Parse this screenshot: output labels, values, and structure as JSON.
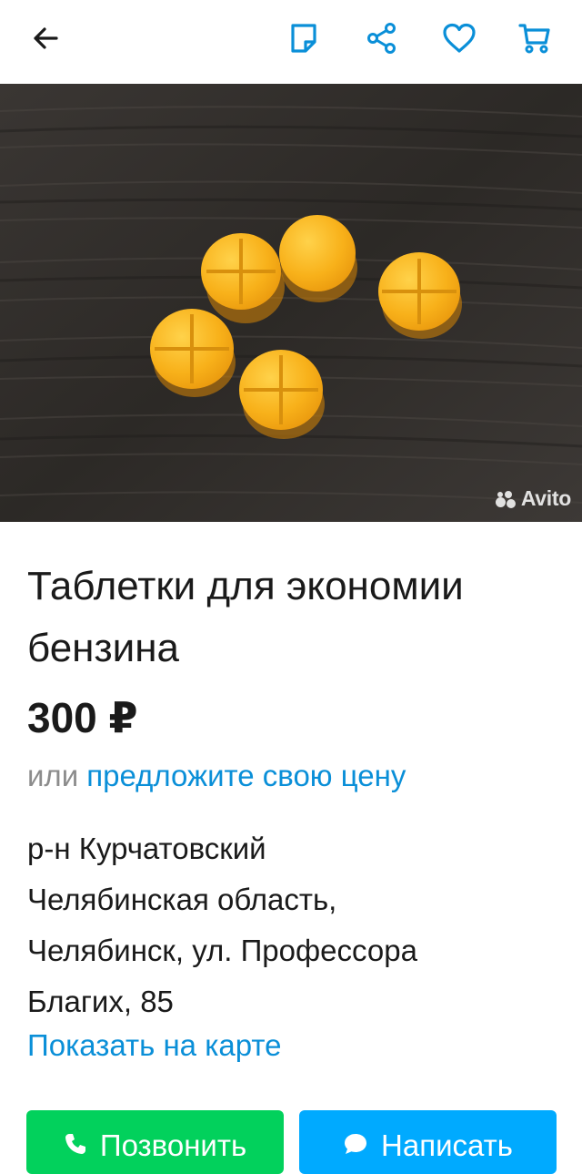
{
  "topbar": {
    "icons": [
      "arrow-left-icon",
      "note-icon",
      "share-icon",
      "heart-icon",
      "cart-icon"
    ]
  },
  "photo": {
    "watermark": "Avito"
  },
  "listing": {
    "title": "Таблетки для экономии бензина",
    "price": "300 ₽",
    "offer_prefix": "или",
    "offer_link": "предложите свою цену",
    "address_lines": [
      "р-н Курчатовский",
      "Челябинская область,",
      "Челябинск, ул. Профессора",
      "Благих, 85"
    ],
    "map_link": "Показать на карте"
  },
  "actions": {
    "call_label": "Позвонить",
    "write_label": "Написать"
  },
  "colors": {
    "accent": "#0a8fd8",
    "call": "#02d15c",
    "write": "#00aaff",
    "secondary_text": "#8c8c8c"
  }
}
